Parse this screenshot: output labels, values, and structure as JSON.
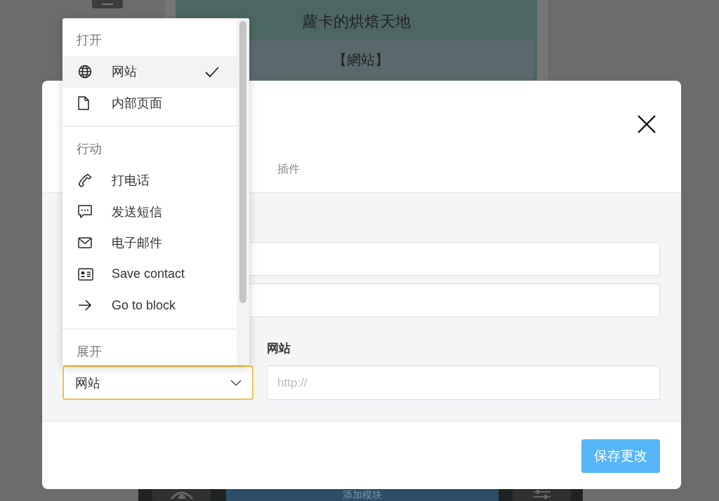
{
  "background": {
    "site_title": "蘿卡的烘焙天地",
    "block_label": "【網站】",
    "add_block_button": "添加模块"
  },
  "modal": {
    "tabs": [
      {
        "label": "插件",
        "selected": false
      }
    ],
    "link_type_select": {
      "value": "网站"
    },
    "url_field": {
      "label": "网站",
      "placeholder": "http://"
    },
    "save_button": "保存更改"
  },
  "dropdown": {
    "sections": [
      {
        "heading": "打开",
        "items": [
          {
            "label": "网站",
            "kind": "globe",
            "selected": true
          },
          {
            "label": "内部页面",
            "kind": "page",
            "selected": false
          }
        ]
      },
      {
        "heading": "行动",
        "items": [
          {
            "label": "打电话",
            "kind": "phone",
            "selected": false
          },
          {
            "label": "发送短信",
            "kind": "message",
            "selected": false
          },
          {
            "label": "电子邮件",
            "kind": "mail",
            "selected": false
          },
          {
            "label": "Save contact",
            "kind": "contact",
            "selected": false
          },
          {
            "label": "Go to block",
            "kind": "arrow",
            "selected": false
          }
        ]
      },
      {
        "heading": "展开"
      }
    ]
  }
}
